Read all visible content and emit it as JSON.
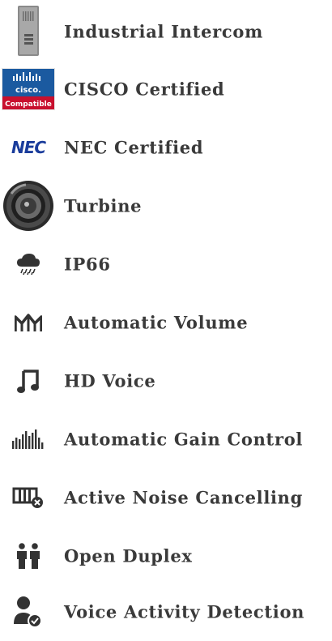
{
  "features": [
    {
      "icon": "intercom-device-icon",
      "label": "Industrial Intercom"
    },
    {
      "icon": "cisco-compatible-logo",
      "label": "CISCO Certified",
      "logo_text": [
        "cisco.",
        "Compatible"
      ]
    },
    {
      "icon": "nec-logo",
      "label": "NEC Certified",
      "logo_text": "NEC"
    },
    {
      "icon": "speaker-turbine-icon",
      "label": "Turbine"
    },
    {
      "icon": "rain-cloud-icon",
      "label": "IP66"
    },
    {
      "icon": "automatic-volume-icon",
      "label": "Automatic Volume"
    },
    {
      "icon": "music-note-icon",
      "label": "HD Voice"
    },
    {
      "icon": "gain-bars-icon",
      "label": "Automatic Gain Control"
    },
    {
      "icon": "noise-cancel-icon",
      "label": "Active Noise Cancelling"
    },
    {
      "icon": "two-people-icon",
      "label": "Open Duplex"
    },
    {
      "icon": "voice-activity-user-icon",
      "label": "Voice Activity Detection"
    }
  ],
  "colors": {
    "text": "#3a3a3a",
    "icon": "#333333",
    "cisco_blue": "#1b5aa0",
    "cisco_red": "#c8102e",
    "nec_blue": "#1a3c9b"
  }
}
